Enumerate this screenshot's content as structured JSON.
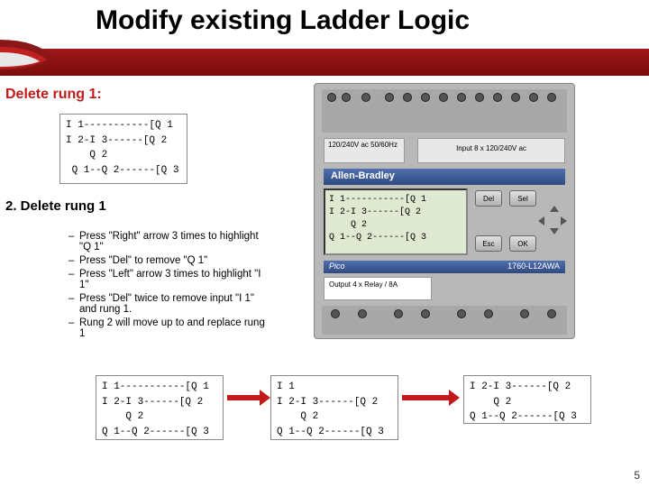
{
  "title": "Modify existing Ladder Logic",
  "subtitle1": "Delete rung 1:",
  "subtitle2": "2. Delete rung 1",
  "steps": [
    "Press \"Right\" arrow 3 times to highlight \"Q 1\"",
    "Press \"Del\" to remove \"Q 1\"",
    "Press \"Left\" arrow 3 times to highlight \"I 1\"",
    "Press \"Del\" twice to remove input \"I 1\" and rung 1.",
    "Rung 2 will move up to and replace rung 1"
  ],
  "ladder_top": "I 1-----------[Q 1\nI 2-I 3------[Q 2\n    Q 2\n Q 1--Q 2------[Q 3",
  "device": {
    "volt_label": "120/240V ac\n50/60Hz",
    "input_label": "Input 8 x 120/240V ac",
    "brand": "Allen-Bradley",
    "screen": "I 1-----------[Q 1\nI 2-I 3------[Q 2\n    Q 2\nQ 1--Q 2------[Q 3",
    "btn_del": "Del",
    "btn_sel": "Sel",
    "btn_esc": "Esc",
    "btn_ok": "OK",
    "model_brand": "Pico",
    "model_num": "1760-L12AWA",
    "output_label": "Output\n4 x Relay / 8A"
  },
  "ladder_b1": "I 1-----------[Q 1\nI 2-I 3------[Q 2\n    Q 2\nQ 1--Q 2------[Q 3",
  "ladder_b2": "I 1\nI 2-I 3------[Q 2\n    Q 2\nQ 1--Q 2------[Q 3",
  "ladder_b3": "I 2-I 3------[Q 2\n    Q 2\nQ 1--Q 2------[Q 3",
  "page": "5"
}
